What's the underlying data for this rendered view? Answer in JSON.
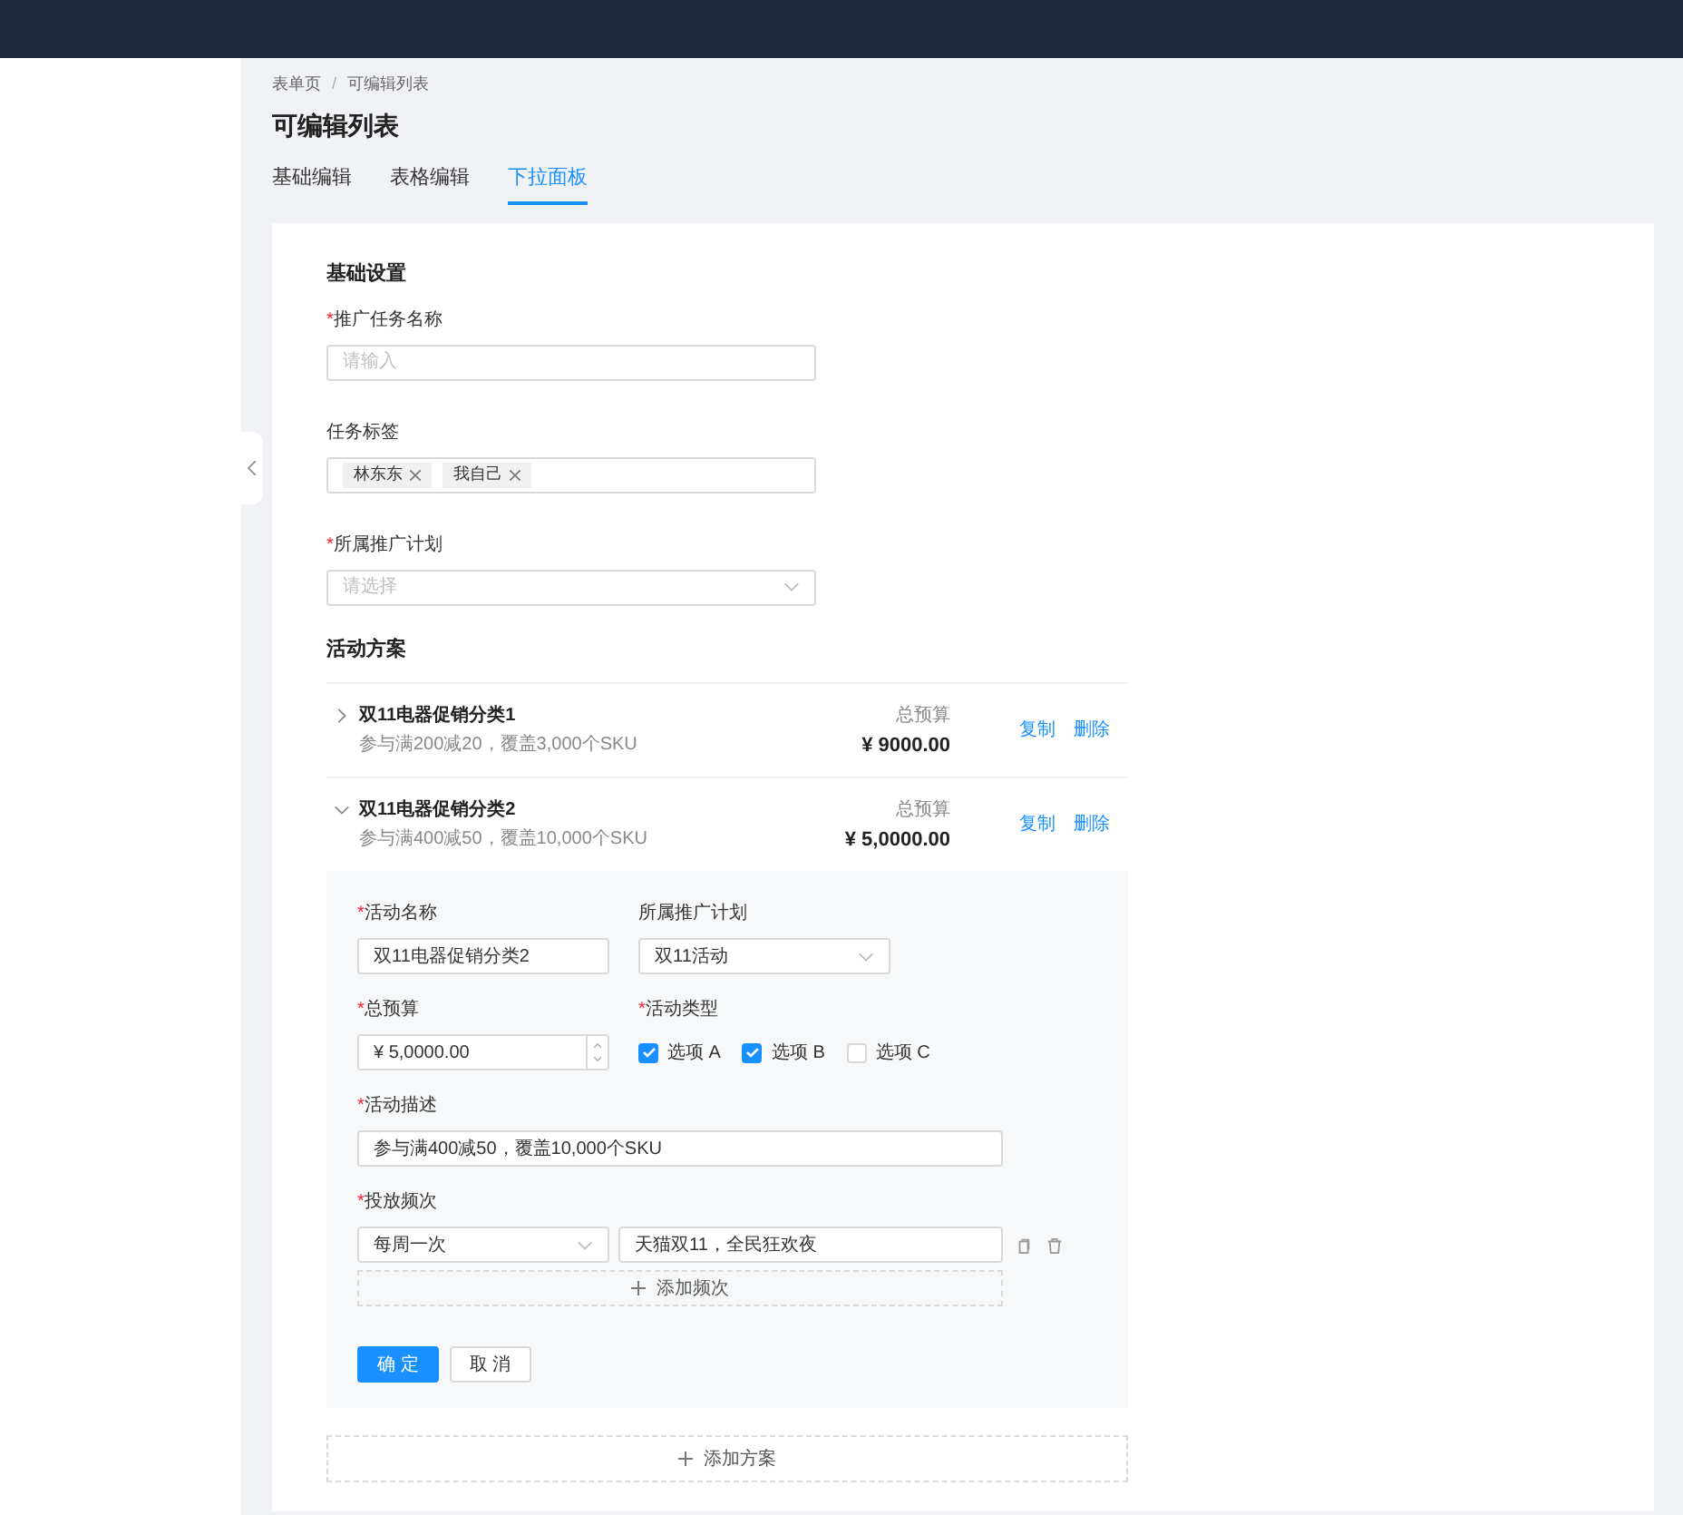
{
  "breadcrumb": [
    "表单页",
    "可编辑列表"
  ],
  "breadcrumb_separator": "/",
  "required_mark": "*",
  "page_title": "可编辑列表",
  "tabs": [
    {
      "label": "基础编辑",
      "selected": false
    },
    {
      "label": "表格编辑",
      "selected": false
    },
    {
      "label": "下拉面板",
      "selected": true
    }
  ],
  "basic": {
    "title": "基础设置",
    "fields": [
      {
        "kind": "input",
        "label": "推广任务名称",
        "required": true,
        "placeholder": "请输入"
      },
      {
        "kind": "tags",
        "label": "任务标签",
        "required": false,
        "tags": [
          "林东东",
          "我自己"
        ]
      },
      {
        "kind": "select",
        "label": "所属推广计划",
        "required": true,
        "placeholder": "请选择"
      }
    ]
  },
  "plans_title": "活动方案",
  "plans": [
    {
      "name": "双11电器促销分类1",
      "desc": "参与满200减20，覆盖3,000个SKU",
      "budget_label": "总预算",
      "budget": "¥ 9000.00",
      "actions": [
        "复制",
        "删除"
      ],
      "expanded": false
    },
    {
      "name": "双11电器促销分类2",
      "desc": "参与满400减50，覆盖10,000个SKU",
      "budget_label": "总预算",
      "budget": "¥ 5,0000.00",
      "actions": [
        "复制",
        "删除"
      ],
      "expanded": true,
      "form": {
        "name": {
          "label": "活动名称",
          "required": true,
          "value": "双11电器促销分类2"
        },
        "plan": {
          "label": "所属推广计划",
          "required": false,
          "value": "双11活动"
        },
        "budget": {
          "label": "总预算",
          "required": true,
          "value": "¥ 5,0000.00"
        },
        "type": {
          "label": "活动类型",
          "required": true,
          "options": [
            {
              "label": "选项 A",
              "checked": true
            },
            {
              "label": "选项 B",
              "checked": true
            },
            {
              "label": "选项 C",
              "checked": false
            }
          ]
        },
        "desc": {
          "label": "活动描述",
          "required": true,
          "value": "参与满400减50，覆盖10,000个SKU"
        },
        "freq": {
          "label": "投放频次",
          "required": true,
          "rows": [
            {
              "period": "每周一次",
              "text": "天猫双11，全民狂欢夜"
            }
          ],
          "add": "添加频次"
        },
        "buttons": [
          {
            "kind": "primary",
            "label": "确 定"
          },
          {
            "kind": "default",
            "label": "取 消"
          }
        ]
      }
    }
  ],
  "add_plan": "添加方案"
}
